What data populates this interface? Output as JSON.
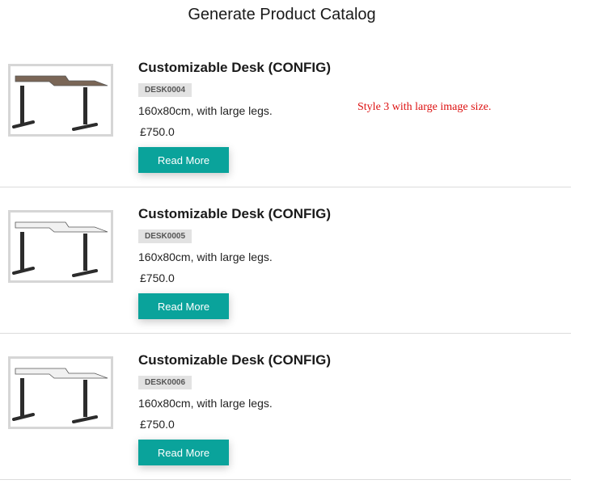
{
  "page": {
    "title": "Generate Product Catalog"
  },
  "note": "Style 3 with large image size.",
  "products": [
    {
      "name": "Customizable Desk (CONFIG)",
      "sku": "DESK0004",
      "description": "160x80cm, with large legs.",
      "price": "£750.0",
      "button_label": "Read More",
      "image": "desk-walnut-image",
      "top_color": "#7a6656"
    },
    {
      "name": "Customizable Desk (CONFIG)",
      "sku": "DESK0005",
      "description": "160x80cm, with large legs.",
      "price": "£750.0",
      "button_label": "Read More",
      "image": "desk-white-image",
      "top_color": "#f1f1f1"
    },
    {
      "name": "Customizable Desk (CONFIG)",
      "sku": "DESK0006",
      "description": "160x80cm, with large legs.",
      "price": "£750.0",
      "button_label": "Read More",
      "image": "desk-white-image",
      "top_color": "#f1f1f1"
    }
  ],
  "colors": {
    "button": "#0aa39b",
    "note": "#dd1111",
    "sku_badge": "#e2e2e2"
  }
}
